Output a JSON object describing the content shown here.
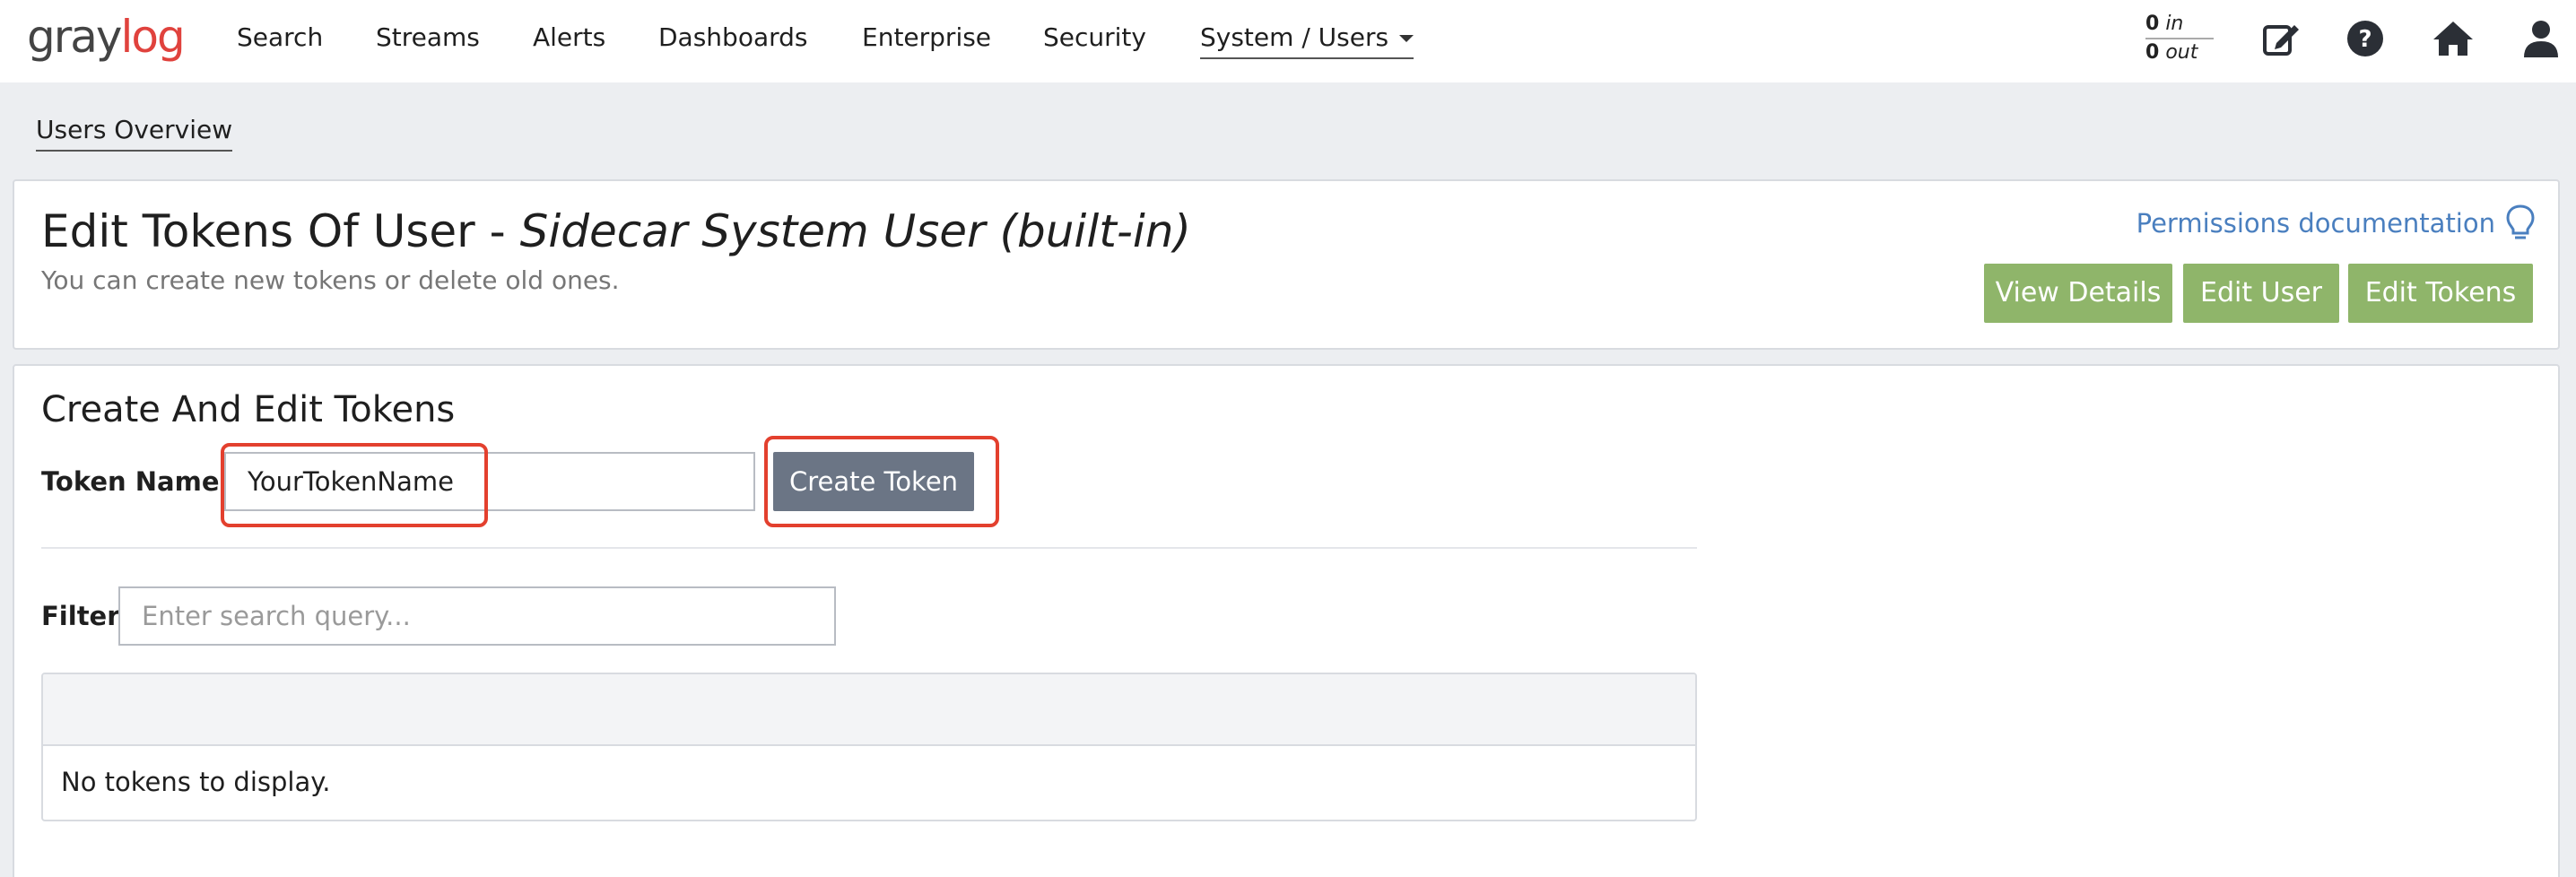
{
  "logo": {
    "text_main": "gray",
    "text_accent": "log"
  },
  "nav": {
    "items": [
      "Search",
      "Streams",
      "Alerts",
      "Dashboards",
      "Enterprise",
      "Security"
    ],
    "system_menu": "System / Users"
  },
  "throughput": {
    "in_value": "0",
    "in_label": "in",
    "out_value": "0",
    "out_label": "out"
  },
  "icons": {
    "edit": "edit-note-icon",
    "help": "help-circle-icon",
    "home": "home-icon",
    "user": "user-icon",
    "bulb": "lightbulb-icon"
  },
  "breadcrumb": {
    "users_overview": "Users Overview"
  },
  "header": {
    "title_prefix": "Edit Tokens Of User - ",
    "title_user": "Sidecar System User (built-in)",
    "subtitle": "You can create new tokens or delete old ones.",
    "doc_link": "Permissions documentation",
    "buttons": {
      "view_details": "View Details",
      "edit_user": "Edit User",
      "edit_tokens": "Edit Tokens"
    }
  },
  "tokens": {
    "section_title": "Create And Edit Tokens",
    "token_name_label": "Token Name",
    "token_name_value": "YourTokenName",
    "create_button": "Create Token",
    "filter_label": "Filter",
    "filter_placeholder": "Enter search query...",
    "empty_message": "No tokens to display."
  },
  "colors": {
    "accent_red": "#e0423d",
    "button_green": "#8fb56a",
    "button_dark": "#6b7585",
    "link_blue": "#4a7fbf",
    "highlight_red": "#e3402e"
  }
}
